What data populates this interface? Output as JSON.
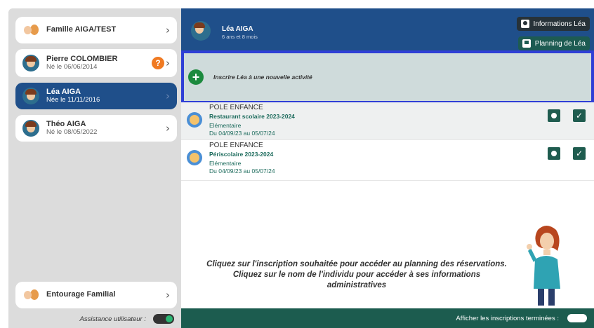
{
  "sidebar": {
    "family": {
      "name": "Famille AIGA/TEST"
    },
    "members": [
      {
        "name": "Pierre COLOMBIER",
        "sub": "Né le 06/06/2014",
        "badge": "?"
      },
      {
        "name": "Léa AIGA",
        "sub": "Née le 11/11/2016"
      },
      {
        "name": "Théo AIGA",
        "sub": "Né le 08/05/2022"
      }
    ],
    "entourage": {
      "name": "Entourage Familial"
    },
    "assistance_label": "Assistance utilisateur :"
  },
  "header": {
    "name": "Léa AIGA",
    "age": "6 ans et 8 mois",
    "btn_info": "Informations Léa",
    "btn_planning": "Planning de Léa"
  },
  "inscrire": {
    "label": "Inscrire Léa à une nouvelle activité"
  },
  "inscriptions": [
    {
      "category": "POLE ENFANCE",
      "title": "Restaurant scolaire 2023-2024",
      "level": "Elémentaire",
      "dates": "Du 04/09/23 au 05/07/24"
    },
    {
      "category": "POLE ENFANCE",
      "title": "Périscolaire 2023-2024",
      "level": "Elémentaire",
      "dates": "Du 04/09/23 au 05/07/24"
    }
  ],
  "message": {
    "line1": "Cliquez sur l'inscription souhaitée pour accéder au planning des réservations.",
    "line2": "Cliquez sur le nom de l'individu pour accéder à ses informations",
    "line3": "administratives"
  },
  "footer": {
    "label": "Afficher les inscriptions terminées :"
  },
  "colors": {
    "primary": "#1f4f8a",
    "accent": "#1c5c4f",
    "highlight_border": "#2f3fd6",
    "badge": "#f07a22"
  },
  "icons": {
    "family": "family-icon",
    "avatar": "child-avatar-icon",
    "question": "question-icon",
    "plus": "plus-icon",
    "folder": "folder-user-icon",
    "calendar": "calendar-check-icon"
  }
}
